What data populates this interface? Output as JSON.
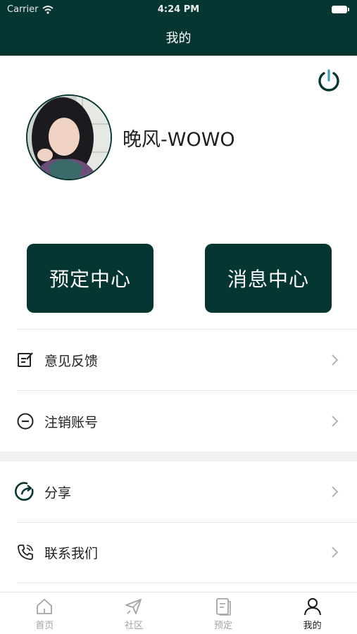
{
  "status_bar": {
    "carrier": "Carrier",
    "time": "4:24 PM"
  },
  "header": {
    "title": "我的"
  },
  "profile": {
    "username": "晚风-WOWO"
  },
  "actions": {
    "booking_center": "预定中心",
    "message_center": "消息中心"
  },
  "menu": {
    "items": [
      {
        "label": "意见反馈",
        "icon": "feedback-icon"
      },
      {
        "label": "注销账号",
        "icon": "minus-circle-icon"
      },
      {
        "label": "分享",
        "icon": "share-icon"
      },
      {
        "label": "联系我们",
        "icon": "phone-icon"
      }
    ]
  },
  "tabbar": {
    "tabs": [
      {
        "label": "首页",
        "icon": "home-icon"
      },
      {
        "label": "社区",
        "icon": "plane-icon"
      },
      {
        "label": "预定",
        "icon": "document-icon"
      },
      {
        "label": "我的",
        "icon": "person-icon",
        "active": true
      }
    ]
  },
  "colors": {
    "primary": "#063631",
    "accent_power": "#3aa0c8",
    "inactive_tab": "#a3a3a3"
  }
}
